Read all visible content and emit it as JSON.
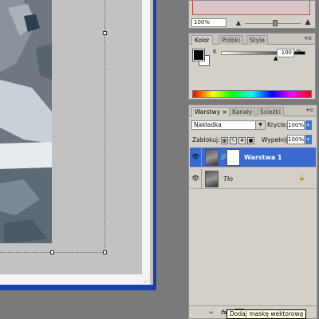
{
  "navigator": {
    "zoom_value": "100%",
    "minus_icon": "zoom-out-icon",
    "plus_icon": "zoom-in-icon"
  },
  "color_panel": {
    "tabs": [
      "Kolor",
      "Próbki",
      "Style"
    ],
    "active_tab": "Kolor",
    "channel_label": "K",
    "channel_value": "100",
    "channel_unit": "%",
    "foreground_color": "#000000",
    "background_color": "#ffffff"
  },
  "layers_panel": {
    "tabs": [
      "Warstwy",
      "Kanały",
      "Ścieżki"
    ],
    "active_tab": "Warstwy",
    "blend_mode": "Nakładka",
    "opacity_label": "Krycie:",
    "opacity_value": "100%",
    "lock_label": "Zablokuj:",
    "fill_label": "Wypełnij:",
    "fill_value": "100%",
    "layers": [
      {
        "name": "Warstwa 1",
        "selected": true,
        "has_mask": true
      },
      {
        "name": "Tło",
        "selected": false,
        "locked": true
      }
    ],
    "footer_buttons": [
      "link-icon",
      "fx-icon",
      "add-mask-icon",
      "adjustment-icon",
      "group-icon",
      "new-layer-icon",
      "trash-icon"
    ],
    "fx_label": "fx."
  },
  "tooltip": "Dodaj maskę wektorową",
  "accent_color": "#3a6ad0",
  "doc_frame_color": "#1c3fa8"
}
